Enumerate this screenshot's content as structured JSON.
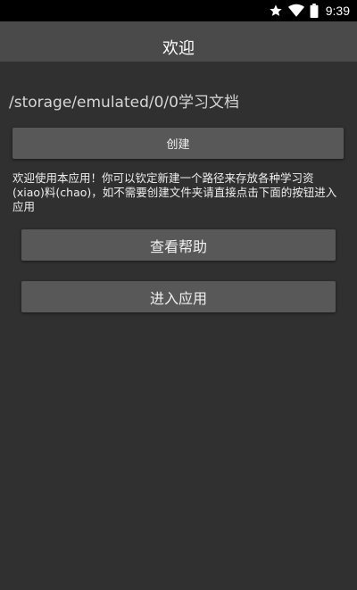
{
  "status_bar": {
    "time": "9:39",
    "icons": [
      "star-icon",
      "wifi-icon",
      "battery-icon"
    ]
  },
  "app_bar": {
    "title": "欢迎"
  },
  "main": {
    "path": "/storage/emulated/0/0学习文档",
    "create_label": "创建",
    "intro": "欢迎使用本应用！你可以钦定新建一个路径来存放各种学习资(xiao)料(chao)，如不需要创建文件夹请直接点击下面的按钮进入应用",
    "help_label": "查看帮助",
    "enter_label": "进入应用"
  },
  "colors": {
    "background": "#303030",
    "app_bar": "#4a4a4a",
    "button": "#585858",
    "status_bar": "#000000"
  }
}
